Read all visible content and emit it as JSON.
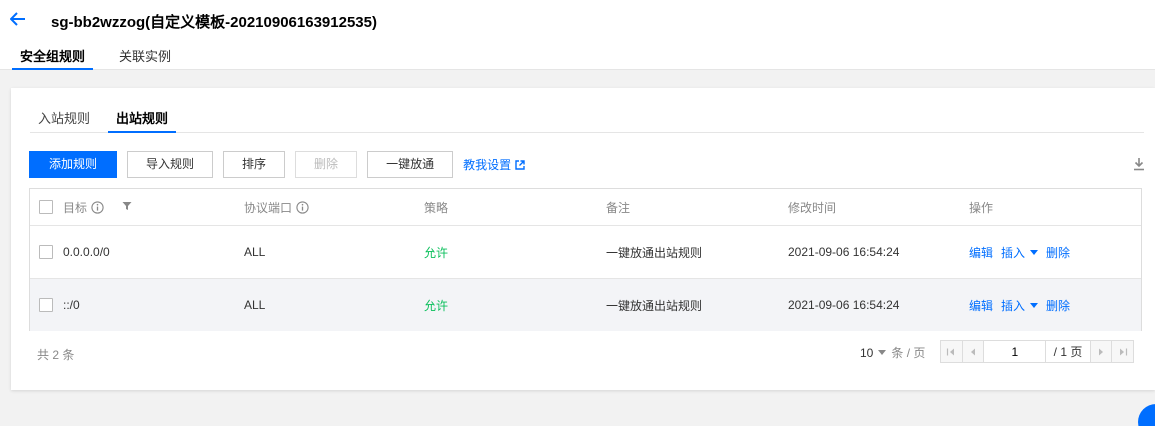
{
  "header": {
    "title": "sg-bb2wzzog(自定义模板-20210906163912535)",
    "tabs": [
      {
        "label": "安全组规则"
      },
      {
        "label": "关联实例"
      }
    ]
  },
  "rules": {
    "tabs": [
      {
        "label": "入站规则"
      },
      {
        "label": "出站规则"
      }
    ],
    "toolbar": {
      "add": "添加规则",
      "import": "导入规则",
      "sort": "排序",
      "delete": "删除",
      "one_click": "一键放通",
      "help": "教我设置"
    },
    "table": {
      "columns": {
        "target": "目标",
        "protocol": "协议端口",
        "policy": "策略",
        "note": "备注",
        "modified": "修改时间",
        "ops": "操作"
      },
      "rows": [
        {
          "target": "0.0.0.0/0",
          "protocol": "ALL",
          "policy": "允许",
          "note": "一键放通出站规则",
          "modified": "2021-09-06 16:54:24"
        },
        {
          "target": "::/0",
          "protocol": "ALL",
          "policy": "允许",
          "note": "一键放通出站规则",
          "modified": "2021-09-06 16:54:24"
        }
      ],
      "ops": {
        "edit": "编辑",
        "insert": "插入",
        "delete": "删除"
      }
    },
    "footer": {
      "total": "共 2 条",
      "page_size": "10",
      "page_size_unit": "条 / 页",
      "current_page": "1",
      "total_pages": "/ 1 页"
    }
  },
  "colors": {
    "primary": "#006eff",
    "allow": "#0abf5b"
  }
}
